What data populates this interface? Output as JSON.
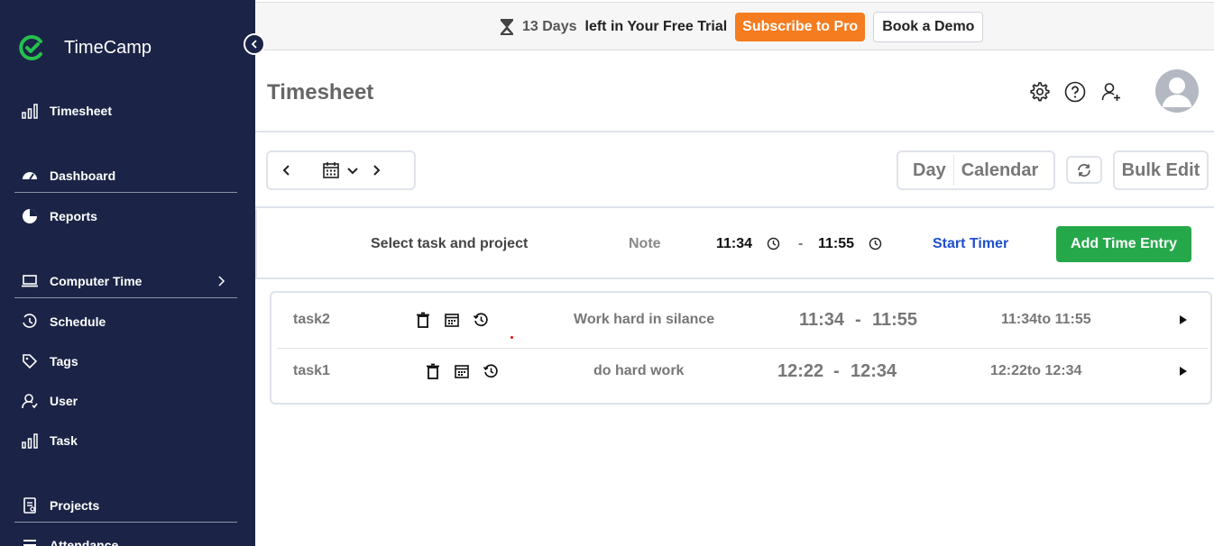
{
  "app": {
    "name": "TimeCamp"
  },
  "sidebar": {
    "items": [
      {
        "label": "Timesheet",
        "icon": "bar-chart-icon"
      },
      {
        "label": "Dashboard",
        "icon": "gauge-icon"
      },
      {
        "label": "Reports",
        "icon": "pie-chart-icon"
      },
      {
        "label": "Computer Time",
        "icon": "laptop-icon"
      },
      {
        "label": "Schedule",
        "icon": "schedule-clock-icon"
      },
      {
        "label": "Tags",
        "icon": "tag-icon"
      },
      {
        "label": "User",
        "icon": "user-icon"
      },
      {
        "label": "Task",
        "icon": "bar-chart-icon"
      },
      {
        "label": "Projects",
        "icon": "clipboard-icon"
      },
      {
        "label": "Attendance",
        "icon": "list-icon"
      }
    ]
  },
  "topbar": {
    "trial_days": "13 Days",
    "trial_text": "left in Your Free Trial",
    "subscribe_label": "Subscribe to Pro",
    "demo_label": "Book a Demo",
    "subscribe_color": "#f57c1f"
  },
  "header": {
    "title": "Timesheet"
  },
  "toolbar": {
    "view_day": "Day",
    "view_calendar": "Calendar",
    "bulk_edit": "Bulk Edit"
  },
  "entry_bar": {
    "task_placeholder": "Select task and project",
    "note_placeholder": "Note",
    "start_time": "11:34",
    "separator": "-",
    "end_time": "11:55",
    "start_timer": "Start Timer",
    "add_entry": "Add Time Entry",
    "add_color": "#25a84a",
    "link_color": "#1e4fcf"
  },
  "entries": [
    {
      "task": "task2",
      "note": "Work hard in silance",
      "start": "11:34",
      "sep": "-",
      "end": "11:55",
      "range": "11:34to 11:55"
    },
    {
      "task": "task1",
      "note": "do hard work",
      "start": "12:22",
      "sep": "-",
      "end": "12:34",
      "range": "12:22to 12:34"
    }
  ]
}
